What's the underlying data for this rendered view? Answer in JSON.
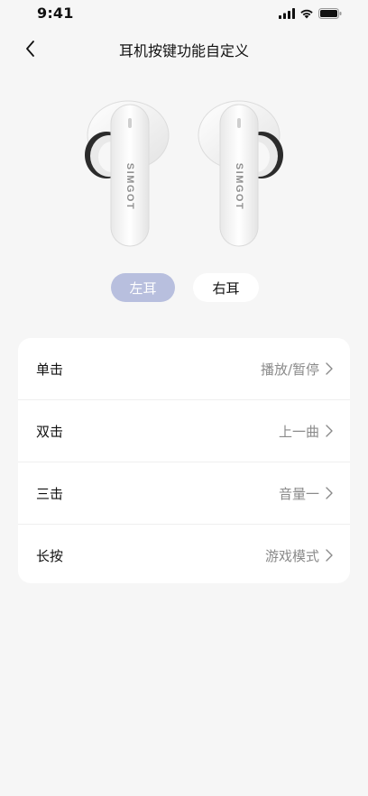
{
  "status_bar": {
    "time": "9:41"
  },
  "header": {
    "title": "耳机按键功能自定义"
  },
  "earbuds": {
    "brand_text": "SIMGOT"
  },
  "ear_toggle": {
    "left_label": "左耳",
    "right_label": "右耳",
    "selected": "left"
  },
  "settings": {
    "items": [
      {
        "label": "单击",
        "value": "播放/暂停"
      },
      {
        "label": "双击",
        "value": "上一曲"
      },
      {
        "label": "三击",
        "value": "音量一"
      },
      {
        "label": "长按",
        "value": "游戏模式"
      }
    ]
  },
  "colors": {
    "background": "#f6f6f6",
    "selected_pill": "#b8bfde",
    "card": "#ffffff",
    "value_text": "#8a8a8a"
  }
}
